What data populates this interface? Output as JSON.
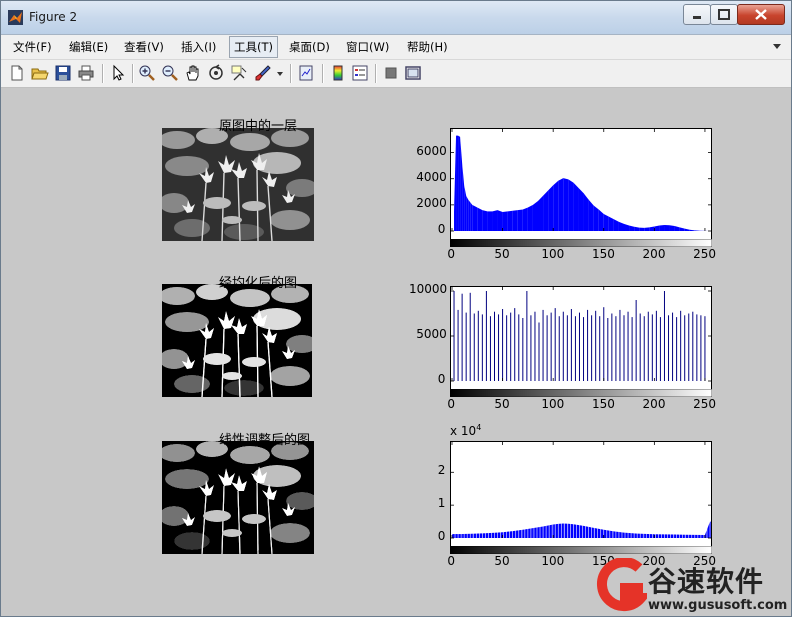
{
  "window": {
    "title": "Figure 2"
  },
  "menu": [
    {
      "label": "文件(F)"
    },
    {
      "label": "编辑(E)"
    },
    {
      "label": "查看(V)"
    },
    {
      "label": "插入(I)"
    },
    {
      "label": "工具(T)"
    },
    {
      "label": "桌面(D)"
    },
    {
      "label": "窗口(W)"
    },
    {
      "label": "帮助(H)"
    }
  ],
  "toolbar": {
    "icons": [
      "new-file-icon",
      "open-folder-icon",
      "save-icon",
      "print-icon",
      "pointer-icon",
      "zoom-in-icon",
      "zoom-out-icon",
      "pan-hand-icon",
      "rotate-3d-icon",
      "data-cursor-icon",
      "brush-icon",
      "brush-dropdown-icon",
      "link-plot-icon",
      "colorbar-icon",
      "legend-icon",
      "hide-tools-icon",
      "show-tools-icon"
    ]
  },
  "panels": [
    {
      "title": "原图中的一层"
    },
    {
      "title": "经均化后的图"
    },
    {
      "title": "线性调整后的图"
    }
  ],
  "chart_data": [
    {
      "type": "bar",
      "title": "",
      "xlabel": "",
      "ylabel": "",
      "xlim": [
        0,
        255
      ],
      "ylim": [
        0,
        7500
      ],
      "xticks": [
        "0",
        "50",
        "100",
        "150",
        "200",
        "250"
      ],
      "yticks": [
        "0",
        "2000",
        "4000",
        "6000"
      ],
      "color": "#0000ff",
      "x": [
        2,
        4,
        6,
        8,
        10,
        12,
        14,
        16,
        18,
        20,
        25,
        30,
        35,
        40,
        45,
        50,
        55,
        60,
        65,
        70,
        75,
        80,
        85,
        90,
        95,
        100,
        105,
        110,
        115,
        120,
        125,
        130,
        135,
        140,
        145,
        150,
        155,
        160,
        165,
        170,
        175,
        180,
        185,
        190,
        195,
        200,
        205,
        210,
        215,
        220,
        225,
        230,
        235,
        240,
        245,
        250,
        255
      ],
      "values": [
        1500,
        7300,
        7300,
        7200,
        5200,
        3500,
        2700,
        2400,
        2200,
        2000,
        1800,
        1600,
        1500,
        1500,
        1600,
        1450,
        1500,
        1550,
        1600,
        1650,
        1800,
        2000,
        2300,
        2700,
        3100,
        3500,
        3850,
        4050,
        3950,
        3700,
        3300,
        2900,
        2400,
        1950,
        1650,
        1300,
        1100,
        900,
        700,
        550,
        420,
        330,
        260,
        240,
        280,
        340,
        420,
        460,
        440,
        380,
        280,
        180,
        100,
        50,
        20,
        10,
        0
      ]
    },
    {
      "type": "bar",
      "title": "",
      "xlabel": "",
      "ylabel": "",
      "xlim": [
        0,
        255
      ],
      "ylim": [
        0,
        10000
      ],
      "xticks": [
        "0",
        "50",
        "100",
        "150",
        "200",
        "250"
      ],
      "yticks": [
        "0",
        "5000",
        "10000"
      ],
      "color": "#000080",
      "x": [
        2,
        6,
        10,
        14,
        18,
        22,
        26,
        30,
        34,
        38,
        42,
        46,
        50,
        54,
        58,
        62,
        66,
        70,
        74,
        78,
        82,
        86,
        90,
        94,
        98,
        102,
        106,
        110,
        114,
        118,
        122,
        126,
        130,
        134,
        138,
        142,
        146,
        150,
        154,
        158,
        162,
        166,
        170,
        174,
        178,
        182,
        186,
        190,
        194,
        198,
        202,
        206,
        210,
        214,
        218,
        222,
        226,
        230,
        234,
        238,
        242,
        246,
        250
      ],
      "values": [
        10000,
        7900,
        9700,
        7600,
        9800,
        7500,
        7800,
        7400,
        10000,
        7200,
        7700,
        7400,
        8000,
        7300,
        7600,
        8100,
        7400,
        7000,
        10000,
        7300,
        7700,
        6500,
        7900,
        7300,
        7600,
        8100,
        7200,
        7700,
        7300,
        8000,
        7200,
        7600,
        7100,
        7900,
        7300,
        7800,
        7200,
        8200,
        7000,
        7500,
        7200,
        7900,
        7300,
        7700,
        7100,
        9000,
        7500,
        7200,
        7700,
        7400,
        7800,
        7100,
        10000,
        7300,
        7600,
        7100,
        7800,
        7300,
        7500,
        7700,
        7400,
        7300,
        7200
      ]
    },
    {
      "type": "bar",
      "title": "",
      "xlabel": "",
      "ylabel": "",
      "xlim": [
        0,
        255
      ],
      "ylim": [
        0,
        28000
      ],
      "exponent": "x 10",
      "exponent_power": "4",
      "xticks": [
        "0",
        "50",
        "100",
        "150",
        "200",
        "250"
      ],
      "yticks": [
        "0",
        "1",
        "2"
      ],
      "color": "#0000ff",
      "x": [
        0,
        10,
        20,
        30,
        40,
        50,
        60,
        70,
        80,
        90,
        100,
        105,
        110,
        115,
        120,
        130,
        140,
        150,
        160,
        170,
        180,
        190,
        200,
        210,
        220,
        230,
        240,
        250,
        255
      ],
      "values": [
        1200,
        1200,
        1300,
        1400,
        1550,
        1750,
        2100,
        2500,
        3000,
        3500,
        4100,
        4300,
        4400,
        4350,
        4200,
        3700,
        3100,
        2500,
        2000,
        1650,
        1400,
        1250,
        1150,
        1100,
        1050,
        1000,
        950,
        900,
        5000
      ]
    }
  ],
  "watermark": {
    "brand": "谷速软件",
    "url": "www.gususoft.com"
  }
}
